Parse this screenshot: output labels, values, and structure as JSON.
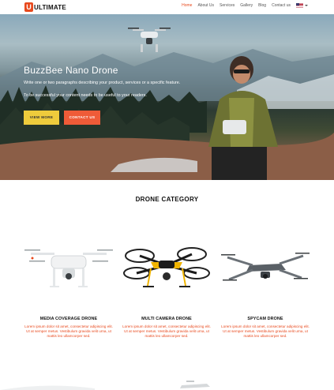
{
  "brand": {
    "logo_mark": "U",
    "name": "ULTIMATE",
    "accent": "#e8491d"
  },
  "nav": {
    "items": [
      {
        "label": "Home",
        "active": true
      },
      {
        "label": "About Us",
        "active": false
      },
      {
        "label": "Services",
        "active": false
      },
      {
        "label": "Gallery",
        "active": false
      },
      {
        "label": "Blog",
        "active": false
      },
      {
        "label": "Contact us",
        "active": false
      }
    ],
    "language_icon": "us-flag-icon"
  },
  "hero": {
    "title": "BuzzBee Nano Drone",
    "line1": "Write one or two paragraphs describing your product, services or a specific feature.",
    "line2": "To be successful your content needs to be useful to your readers.",
    "view_more": "VIEW MORE",
    "contact_us": "CONTACT US",
    "colors": {
      "view_more_bg": "#eecb3c",
      "contact_bg": "#ef5b38"
    }
  },
  "category": {
    "title": "DRONE CATEGORY",
    "cards": [
      {
        "title": "MEDIA COVERAGE DRONE",
        "desc": [
          "Lorem ipsum dolor sit amet, consectetur adipiscing elit.",
          "Ut at semper metus. Vestibulum gravida velit urna, ut",
          "mattis leo ullamcorper sed."
        ]
      },
      {
        "title": "MULTI CAMERA DRONE",
        "desc": [
          "Lorem ipsum dolor sit amet, consectetur adipiscing elit.",
          "Ut at semper metus. Vestibulum gravida velit urna, ut",
          "mattis leo ullamcorper sed."
        ]
      },
      {
        "title": "SPYCAM DRONE",
        "desc": [
          "Lorem ipsum dolor sit amet, consectetur adipiscing elit.",
          "Ut at semper metus. Vestibulum gravida velit urna, ut",
          "mattis leo ullamcorper sed."
        ]
      }
    ]
  }
}
